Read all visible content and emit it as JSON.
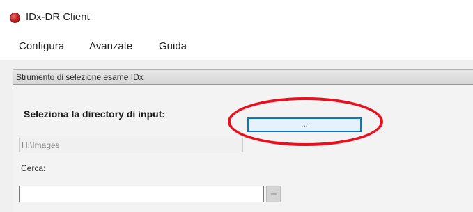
{
  "window": {
    "title": "IDx-DR Client"
  },
  "menu": {
    "items": [
      "Configura",
      "Avanzate",
      "Guida"
    ]
  },
  "section": {
    "title": "Strumento di selezione esame IDx"
  },
  "input_dir": {
    "label": "Seleziona la directory di input:",
    "browse_label": "...",
    "path_value": "H:\\Images"
  },
  "search": {
    "label": "Cerca:",
    "value": ""
  },
  "colors": {
    "highlight": "#e8101e",
    "button_border": "#0078d7",
    "app_icon": "#c21f1f"
  },
  "icons": {
    "app": "red-circle-icon"
  }
}
